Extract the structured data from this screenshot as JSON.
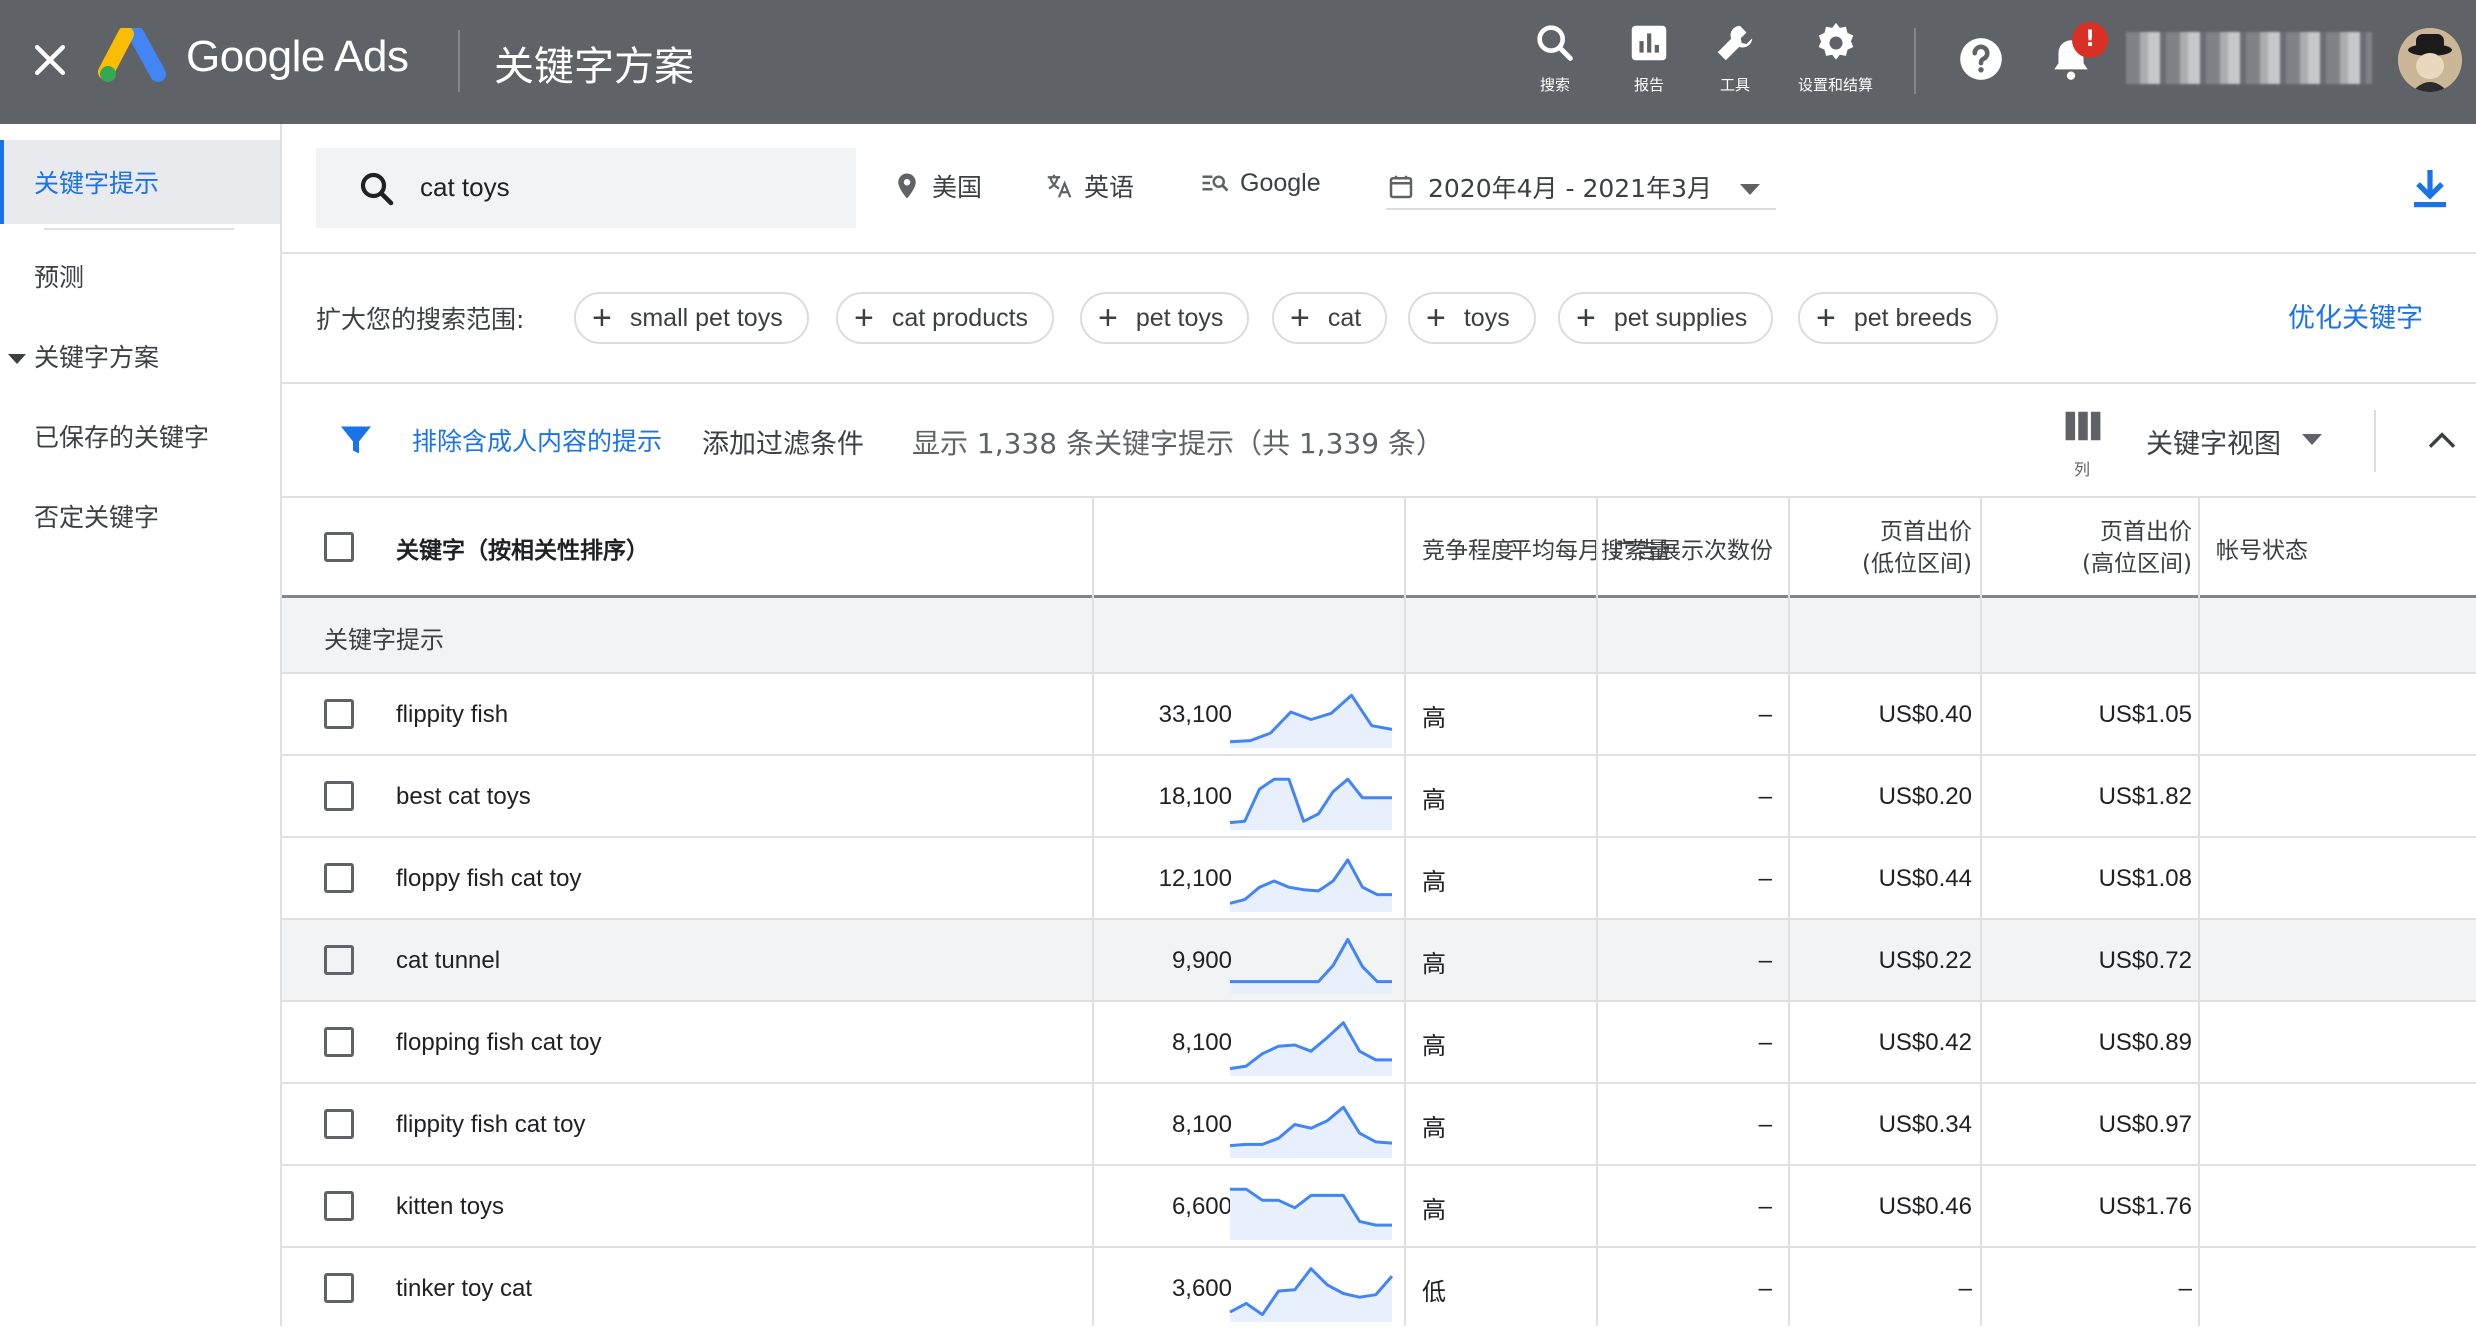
{
  "topbar": {
    "brand": "Google Ads",
    "title": "关键字方案",
    "tools": [
      {
        "label": "搜索",
        "icon": "search-icon"
      },
      {
        "label": "报告",
        "icon": "report-icon"
      },
      {
        "label": "工具",
        "icon": "wrench-icon"
      },
      {
        "label": "设置和结算",
        "icon": "gear-icon"
      }
    ],
    "alert_badge": "!"
  },
  "sidebar": {
    "items": [
      {
        "label": "关键字提示",
        "active": true
      },
      {
        "label": "预测"
      },
      {
        "label": "关键字方案",
        "expanded": true
      },
      {
        "label": "已保存的关键字"
      },
      {
        "label": "否定关键字"
      }
    ]
  },
  "search": {
    "query": "cat toys",
    "location": "美国",
    "language": "英语",
    "network": "Google",
    "date_range": "2020年4月 - 2021年3月"
  },
  "broaden": {
    "label": "扩大您的搜索范围:",
    "chips": [
      "small pet toys",
      "cat products",
      "pet toys",
      "cat",
      "toys",
      "pet supplies",
      "pet breeds"
    ],
    "refine_label": "优化关键字"
  },
  "filters": {
    "exclude_adult": "排除含成人内容的提示",
    "add_filter": "添加过滤条件",
    "count_text": "显示 1,338 条关键字提示（共 1,339 条）",
    "columns_label": "列",
    "view_label": "关键字视图"
  },
  "table": {
    "headers": {
      "keyword": "关键字（按相关性排序）",
      "avg_searches": "平均每月搜索量",
      "competition": "竞争程度",
      "impression_share": "广告展示次数份",
      "bid_low_1": "页首出价",
      "bid_low_2": "(低位区间)",
      "bid_high_1": "页首出价",
      "bid_high_2": "(高位区间)",
      "account_status": "帐号状态"
    },
    "group_label": "关键字提示",
    "rows": [
      {
        "keyword": "flippity fish",
        "searches": "33,100",
        "trend": [
          10,
          12,
          24,
          58,
          46,
          56,
          85,
          36,
          30
        ],
        "competition": "高",
        "share": "–",
        "bid_low": "US$0.40",
        "bid_high": "US$1.05"
      },
      {
        "keyword": "best cat toys",
        "searches": "18,100",
        "trend": [
          12,
          14,
          66,
          82,
          82,
          14,
          26,
          62,
          82,
          52,
          52,
          52
        ],
        "competition": "高",
        "share": "–",
        "bid_low": "US$0.20",
        "bid_high": "US$1.82"
      },
      {
        "keyword": "floppy fish cat toy",
        "searches": "12,100",
        "trend": [
          14,
          20,
          40,
          50,
          40,
          36,
          34,
          50,
          84,
          40,
          28,
          28
        ],
        "competition": "高",
        "share": "–",
        "bid_low": "US$0.44",
        "bid_high": "US$1.08"
      },
      {
        "keyword": "cat tunnel",
        "searches": "9,900",
        "trend": [
          20,
          20,
          20,
          20,
          20,
          20,
          20,
          46,
          88,
          44,
          20,
          20
        ],
        "competition": "高",
        "share": "–",
        "bid_low": "US$0.22",
        "bid_high": "US$0.72"
      },
      {
        "keyword": "flopping fish cat toy",
        "searches": "8,100",
        "trend": [
          12,
          16,
          36,
          48,
          50,
          40,
          62,
          86,
          40,
          26,
          26
        ],
        "competition": "高",
        "share": "–",
        "bid_low": "US$0.42",
        "bid_high": "US$0.89"
      },
      {
        "keyword": "flippity fish cat toy",
        "searches": "8,100",
        "trend": [
          20,
          22,
          22,
          32,
          54,
          48,
          60,
          82,
          40,
          26,
          24
        ],
        "competition": "高",
        "share": "–",
        "bid_low": "US$0.34",
        "bid_high": "US$0.97"
      },
      {
        "keyword": "kitten toys",
        "searches": "6,600",
        "trend": [
          82,
          82,
          64,
          64,
          52,
          72,
          72,
          72,
          30,
          24,
          24
        ],
        "competition": "高",
        "share": "–",
        "bid_low": "US$0.46",
        "bid_high": "US$1.76"
      },
      {
        "keyword": "tinker toy cat",
        "searches": "3,600",
        "trend": [
          16,
          30,
          12,
          50,
          52,
          86,
          60,
          46,
          40,
          44,
          74
        ],
        "competition": "低",
        "share": "–",
        "bid_low": "–",
        "bid_high": "–"
      }
    ]
  },
  "colors": {
    "topbar": "#5f6368",
    "accent": "#1a73e8",
    "alert": "#d93025",
    "spark_line": "#4285f4",
    "spark_fill": "#e8f0fe"
  }
}
